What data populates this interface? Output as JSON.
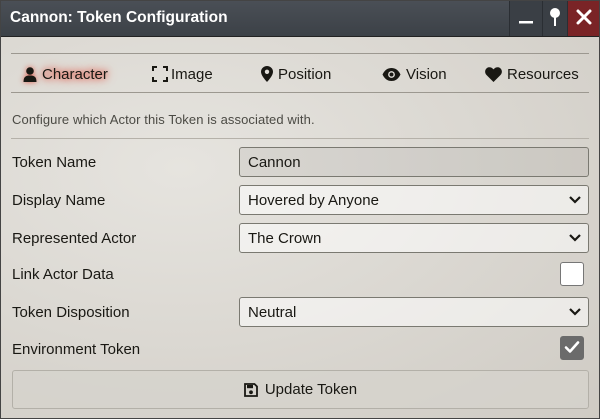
{
  "window": {
    "title": "Cannon: Token Configuration",
    "controls": [
      "minimize-icon",
      "pin-icon",
      "close-icon"
    ]
  },
  "tabs": [
    {
      "label": "Character",
      "icon": "user-icon",
      "active": true
    },
    {
      "label": "Image",
      "icon": "expand-icon",
      "active": false
    },
    {
      "label": "Position",
      "icon": "map-marker-icon",
      "active": false
    },
    {
      "label": "Vision",
      "icon": "eye-icon",
      "active": false
    },
    {
      "label": "Resources",
      "icon": "heart-icon",
      "active": false
    }
  ],
  "hint": "Configure which Actor this Token is associated with.",
  "form": {
    "token_name": {
      "label": "Token Name",
      "value": "Cannon"
    },
    "display_name": {
      "label": "Display Name",
      "value": "Hovered by Anyone"
    },
    "represented_actor": {
      "label": "Represented Actor",
      "value": "The Crown"
    },
    "link_actor_data": {
      "label": "Link Actor Data",
      "checked": false
    },
    "token_disposition": {
      "label": "Token Disposition",
      "value": "Neutral"
    },
    "environment_token": {
      "label": "Environment Token",
      "checked": true
    }
  },
  "submit": {
    "label": "Update Token",
    "icon": "save-icon"
  },
  "colors": {
    "titlebar": "#3c4147",
    "close": "#7a2426",
    "active_glow": "#e05a4a",
    "text": "#191813"
  }
}
